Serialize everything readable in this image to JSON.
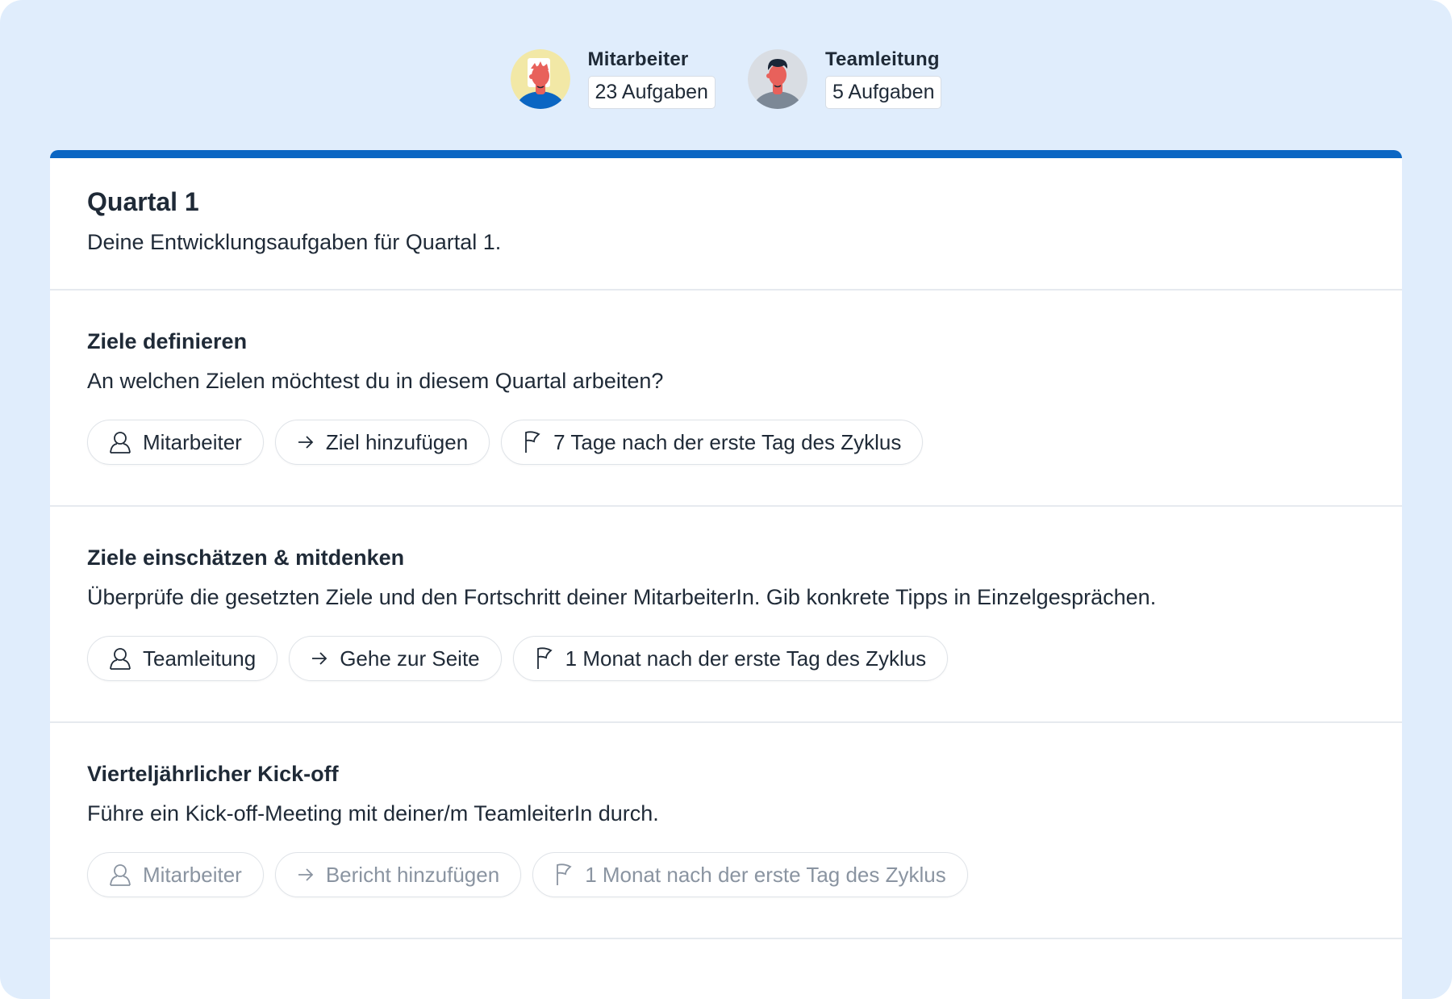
{
  "roles": [
    {
      "name": "Mitarbeiter",
      "count": "23 Aufgaben"
    },
    {
      "name": "Teamleitung",
      "count": "5 Aufgaben"
    }
  ],
  "quarter": {
    "title": "Quartal 1",
    "subtitle": "Deine Entwicklungsaufgaben für Quartal 1."
  },
  "tasks": [
    {
      "title": "Ziele definieren",
      "description": "An welchen Zielen möchtest du in diesem Quartal arbeiten?",
      "assignee": "Mitarbeiter",
      "action": "Ziel hinzufügen",
      "deadline": "7 Tage nach der erste Tag des Zyklus"
    },
    {
      "title": "Ziele einschätzen & mitdenken",
      "description": "Überprüfe die gesetzten Ziele und den Fortschritt deiner MitarbeiterIn. Gib konkrete Tipps in Einzelgesprächen.",
      "assignee": "Teamleitung",
      "action": "Gehe zur Seite",
      "deadline": "1 Monat nach der erste Tag des Zyklus"
    },
    {
      "title": "Vierteljährlicher Kick-off",
      "description": "Führe ein Kick-off-Meeting mit deiner/m TeamleiterIn durch.",
      "assignee": "Mitarbeiter",
      "action": "Bericht hinzufügen",
      "deadline": "1 Monat nach der erste Tag des Zyklus"
    }
  ],
  "icons": {
    "assignee": "user-icon",
    "action": "arrow-right-icon",
    "deadline": "flag-icon"
  },
  "colors": {
    "background": "#e0edfc",
    "accent": "#0b66c3",
    "muted_text": "#8a94a1"
  }
}
